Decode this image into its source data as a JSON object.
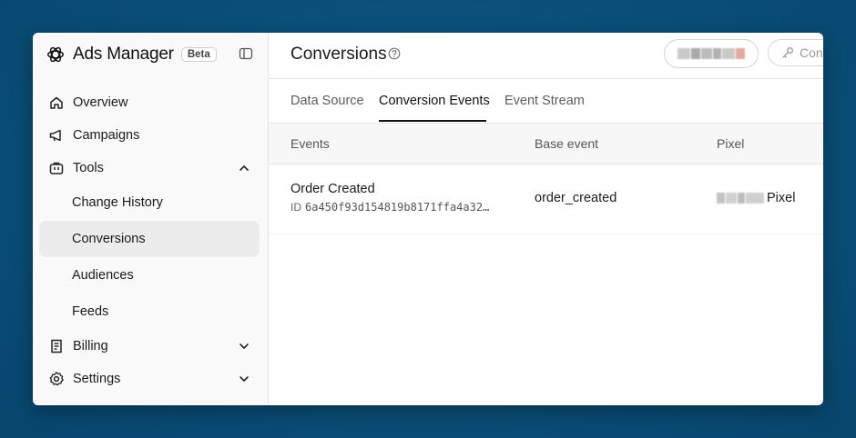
{
  "app": {
    "title": "Ads Manager",
    "badge": "Beta"
  },
  "sidebar": {
    "items": [
      {
        "label": "Overview",
        "icon": "home-icon"
      },
      {
        "label": "Campaigns",
        "icon": "megaphone-icon"
      },
      {
        "label": "Tools",
        "icon": "toolbox-icon",
        "expanded": true,
        "children": [
          "Change History",
          "Conversions",
          "Audiences",
          "Feeds"
        ]
      },
      {
        "label": "Billing",
        "icon": "receipt-icon",
        "expanded": false
      },
      {
        "label": "Settings",
        "icon": "gear-icon",
        "expanded": false
      }
    ],
    "active": "Conversions"
  },
  "header": {
    "title": "Conversions",
    "connect_label": "Con"
  },
  "tabs": [
    {
      "label": "Data Source"
    },
    {
      "label": "Conversion Events"
    },
    {
      "label": "Event Stream"
    }
  ],
  "active_tab": "Conversion Events",
  "table": {
    "columns": [
      "Events",
      "Base event",
      "Pixel"
    ],
    "rows": [
      {
        "name": "Order Created",
        "id_label": "ID",
        "id": "6a450f93d154819b8171ffa4a32…",
        "base_event": "order_created",
        "pixel": "Pixel"
      }
    ]
  },
  "colors": {
    "accent": "#111111",
    "active_bg": "#ececec",
    "backdrop": "#0a4f79"
  }
}
